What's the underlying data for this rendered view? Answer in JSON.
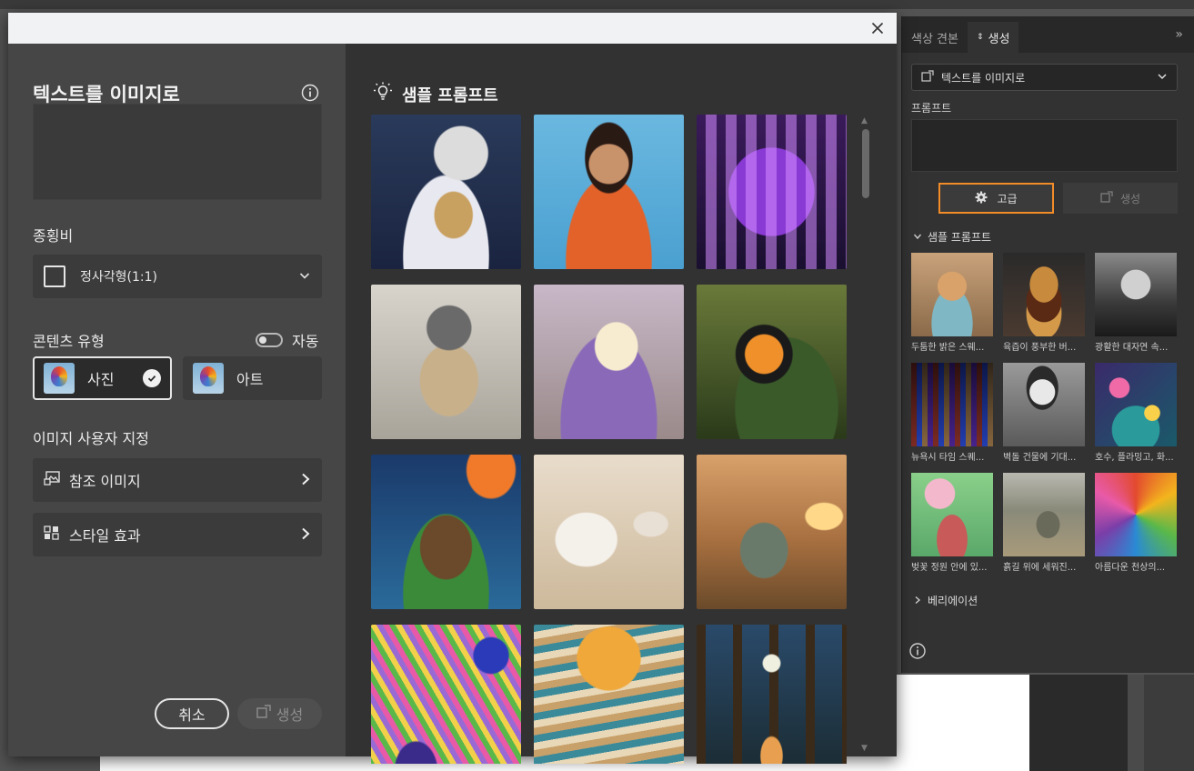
{
  "dialog": {
    "title": "텍스트를 이미지로",
    "aspect_label": "종횡비",
    "aspect_value": "정사각형(1:1)",
    "content_type_label": "콘텐츠 유형",
    "auto_label": "자동",
    "content_types": [
      {
        "label": "사진",
        "selected": true
      },
      {
        "label": "아트",
        "selected": false
      }
    ],
    "customize_label": "이미지 사용자 지정",
    "reference_image_label": "참조 이미지",
    "style_effects_label": "스타일 효과",
    "cancel_label": "취소",
    "generate_label": "생성",
    "sample_title": "샘플 프롬프트",
    "samples": [
      {
        "name": "paper-art-winter-house"
      },
      {
        "name": "3d-woman-glasses"
      },
      {
        "name": "happy-birthday-balloons"
      },
      {
        "name": "french-bulldog-king"
      },
      {
        "name": "lavender-hall"
      },
      {
        "name": "butterfly-leaf"
      },
      {
        "name": "dinosaur-space"
      },
      {
        "name": "paper-vase"
      },
      {
        "name": "vintage-car-sunset"
      },
      {
        "name": "peacock-feathers"
      },
      {
        "name": "sun-landscape"
      },
      {
        "name": "girl-lantern-forest"
      }
    ]
  },
  "panel": {
    "tabs": [
      "색상 견본",
      "생성"
    ],
    "active_tab": "생성",
    "mode_value": "텍스트를 이미지로",
    "prompt_label": "프롬프트",
    "advanced_label": "고급",
    "generate_label": "생성",
    "sample_section": "샘플 프롬프트",
    "samples": [
      {
        "caption": "두툼한 밝은 스웨..."
      },
      {
        "caption": "육즙이 풍부한 버..."
      },
      {
        "caption": "광활한 대자연 속..."
      },
      {
        "caption": "뉴욕시 타임 스퀘..."
      },
      {
        "caption": "벽돌 건물에 기대..."
      },
      {
        "caption": "호수, 플라밍고, 화..."
      },
      {
        "caption": "벚꽃 정원 안에 있..."
      },
      {
        "caption": "흙길 위에 세워진..."
      },
      {
        "caption": "아름다운 천상의..."
      }
    ],
    "variation_label": "베리에이션"
  },
  "colors": {
    "accent_highlight": "#f28c28",
    "dialog_bg": "#464646",
    "sample_bg": "#323232"
  }
}
